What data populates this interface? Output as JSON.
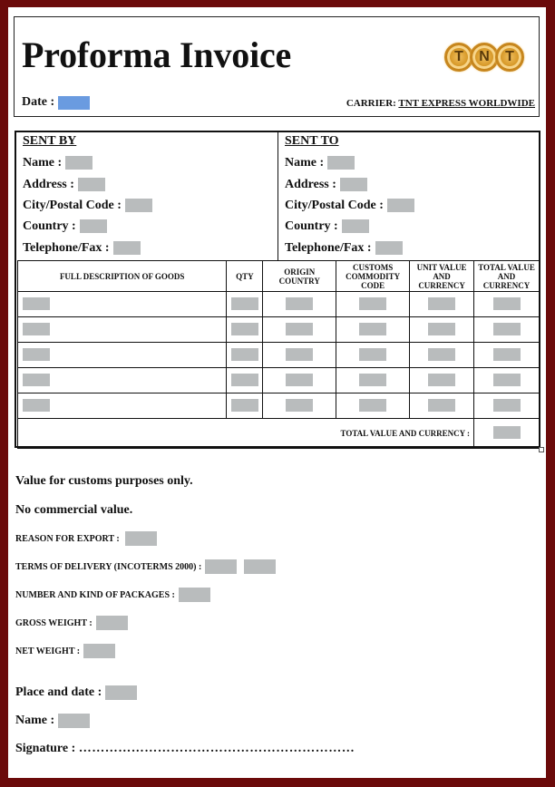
{
  "header": {
    "title": "Proforma Invoice",
    "date_label": "Date :",
    "carrier_label": "CARRIER:",
    "carrier_value": "TNT EXPRESS  WORLDWIDE",
    "logo_letters": [
      "T",
      "N",
      "T"
    ],
    "logo_name": "TNT"
  },
  "sent_by": {
    "title": "SENT BY",
    "fields": [
      "Name :",
      "Address :",
      "City/Postal Code :",
      "Country :",
      "Telephone/Fax :"
    ]
  },
  "sent_to": {
    "title": "SENT TO",
    "fields": [
      "Name :",
      "Address :",
      "City/Postal Code :",
      "Country :",
      "Telephone/Fax :"
    ]
  },
  "goods_table": {
    "columns": [
      "FULL DESCRIPTION OF GOODS",
      "QTY",
      "ORIGIN COUNTRY",
      "CUSTOMS COMMODITY CODE",
      "UNIT VALUE AND CURRENCY",
      "TOTAL VALUE AND CURRENCY"
    ],
    "row_count": 5,
    "total_label": "TOTAL VALUE AND CURRENCY :"
  },
  "notes": {
    "customs_only": "Value for customs purposes only.",
    "no_commercial": "No commercial value.",
    "reason_for_export": "REASON FOR EXPORT :",
    "terms_of_delivery": "TERMS OF DELIVERY (INCOTERMS 2000) :",
    "packages": "NUMBER AND KIND OF PACKAGES :",
    "gross_weight": "GROSS WEIGHT :",
    "net_weight": "NET WEIGHT :",
    "place_and_date": "Place and date :",
    "name": "Name :",
    "signature": "Signature :",
    "signature_line": "………………………………………………………"
  },
  "colors": {
    "frame": "#6b0a0a",
    "date_field": "#6a9be0",
    "blank_field": "#b9bcbd"
  }
}
